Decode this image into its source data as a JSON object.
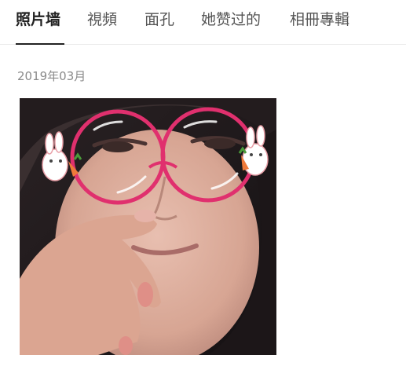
{
  "tabs": [
    {
      "label": "照片墙",
      "active": true
    },
    {
      "label": "視頻",
      "active": false
    },
    {
      "label": "面孔",
      "active": false
    },
    {
      "label": "她赞过的",
      "active": false
    },
    {
      "label": "相冊專輯",
      "active": false
    }
  ],
  "photos_section": {
    "date_label": "2019年03月"
  },
  "colors": {
    "active_tab": "#222222",
    "inactive_tab": "#555555",
    "date_text": "#8a8a8a",
    "glasses_frame": "#e0306e"
  }
}
